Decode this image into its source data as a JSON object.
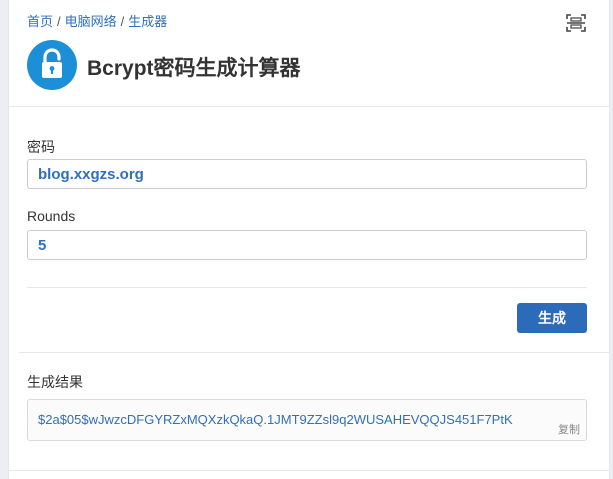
{
  "breadcrumb": {
    "home": "首页",
    "category": "电脑网络",
    "current": "生成器",
    "separator": "/"
  },
  "header": {
    "title": "Bcrypt密码生成计算器"
  },
  "form": {
    "password_label": "密码",
    "password_value": "blog.xxgzs.org",
    "rounds_label": "Rounds",
    "rounds_value": "5",
    "generate_label": "生成"
  },
  "result": {
    "label": "生成结果",
    "value": "$2a$05$wJwzcDFGYRZxMQXzkQkaQ.1JMT9ZZsl9q2WUSAHEVQQJS451F7PtK",
    "copy_label": "复制"
  },
  "colors": {
    "accent": "#2b6bb9",
    "icon_bg": "#1d8fd6",
    "link": "#2f6fbd"
  },
  "icons": {
    "scan": "scan-icon",
    "lock": "lock-icon"
  }
}
